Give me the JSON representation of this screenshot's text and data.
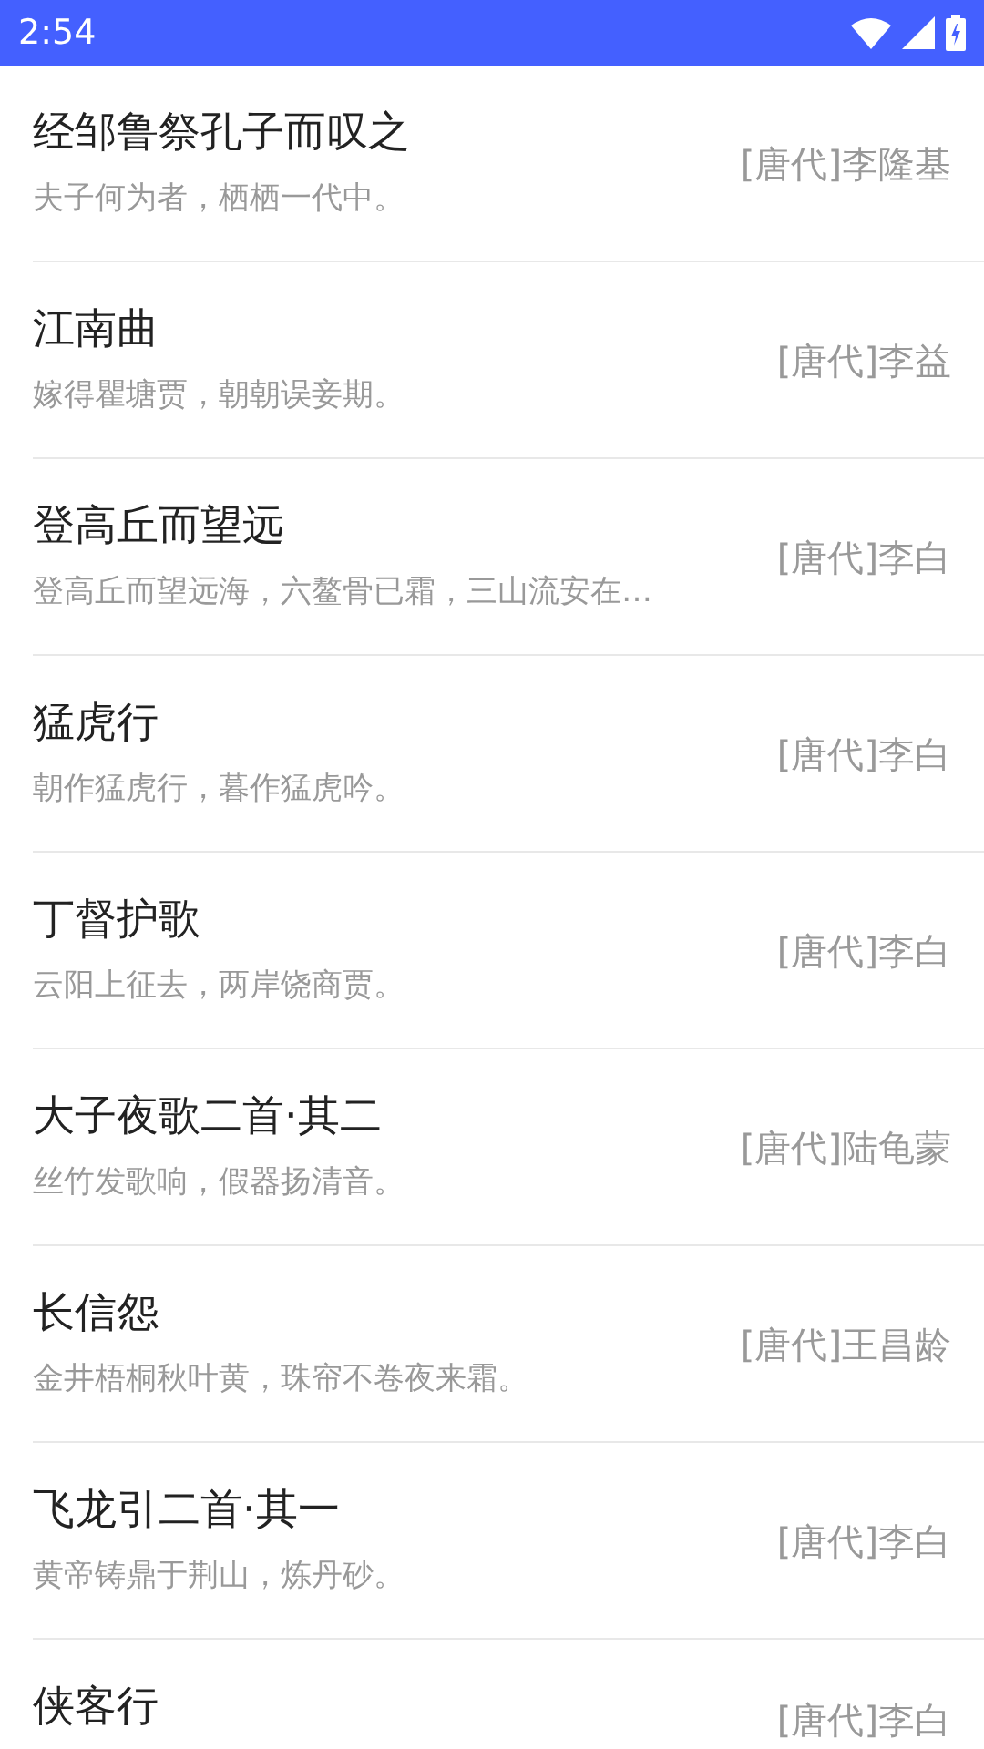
{
  "status_bar": {
    "time": "2:54"
  },
  "poems": [
    {
      "title": "经邹鲁祭孔子而叹之",
      "excerpt": "夫子何为者，栖栖一代中。",
      "author": "[唐代]李隆基"
    },
    {
      "title": "江南曲",
      "excerpt": "嫁得瞿塘贾，朝朝误妾期。",
      "author": "[唐代]李益"
    },
    {
      "title": "登高丘而望远",
      "excerpt": "登高丘而望远海，六鳌骨已霜，三山流安在…",
      "author": "[唐代]李白"
    },
    {
      "title": "猛虎行",
      "excerpt": "朝作猛虎行，暮作猛虎吟。",
      "author": "[唐代]李白"
    },
    {
      "title": "丁督护歌",
      "excerpt": "云阳上征去，两岸饶商贾。",
      "author": "[唐代]李白"
    },
    {
      "title": "大子夜歌二首·其二",
      "excerpt": "丝竹发歌响，假器扬清音。",
      "author": "[唐代]陆龟蒙"
    },
    {
      "title": "长信怨",
      "excerpt": "金井梧桐秋叶黄，珠帘不卷夜来霜。",
      "author": "[唐代]王昌龄"
    },
    {
      "title": "飞龙引二首·其一",
      "excerpt": "黄帝铸鼎于荆山，炼丹砂。",
      "author": "[唐代]李白"
    },
    {
      "title": "侠客行",
      "author": "[唐代]李白"
    }
  ]
}
